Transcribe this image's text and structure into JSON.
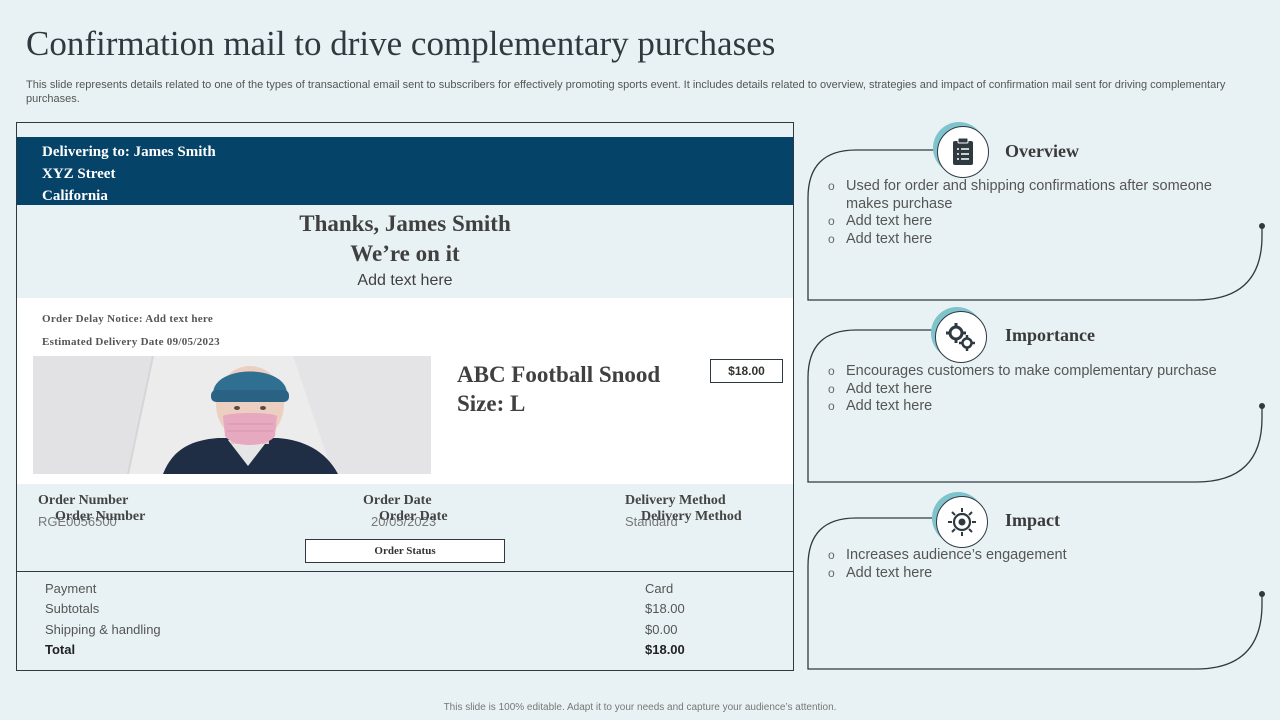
{
  "slide": {
    "title": "Confirmation mail to drive complementary purchases",
    "subtitle": "This slide represents details related to one of the types of transactional email sent to subscribers for effectively promoting sports event. It includes details related to overview, strategies and impact of confirmation mail sent for driving complementary purchases.",
    "footer": "This slide is 100% editable. Adapt it to your needs and capture your audience’s attention."
  },
  "email": {
    "delivering_to": "Delivering to: James Smith",
    "street": "XYZ Street",
    "state": "California",
    "thanks_line": "Thanks, James Smith",
    "on_it_line": "We’re on it",
    "add_text": "Add text here",
    "delay_notice": "Order Delay Notice: Add text here",
    "estimated_delivery": "Estimated Delivery Date 09/05/2023",
    "product_name": "ABC Football Snood",
    "product_size": "Size: L",
    "price": "$18.00",
    "order_headers": {
      "number": "Order Number",
      "date": "Order Date",
      "method": "Delivery Method"
    },
    "order_values": {
      "number": "RGE0056500",
      "date": "20/05/2023",
      "method": "Standard"
    },
    "order_status": "Order Status",
    "payment_rows": [
      {
        "label": "Payment",
        "value": "Card"
      },
      {
        "label": "Subtotals",
        "value": "$18.00"
      },
      {
        "label": "Shipping & handling",
        "value": "$0.00"
      },
      {
        "label": "Total",
        "value": "$18.00"
      }
    ]
  },
  "panels": [
    {
      "title": "Overview",
      "icon": "clipboard-icon",
      "bullets": [
        "Used for order and shipping confirmations after someone makes purchase",
        "Add text here",
        "Add text here"
      ]
    },
    {
      "title": "Importance",
      "icon": "gears-icon",
      "bullets": [
        "Encourages customers to make complementary purchase",
        "Add text here",
        "Add text here"
      ]
    },
    {
      "title": "Impact",
      "icon": "target-icon",
      "bullets": [
        "Increases audience’s engagement",
        "Add text here"
      ]
    }
  ],
  "colors": {
    "background": "#e8f2f4",
    "header_band": "#064369",
    "icon_accent": "#7fc3cc"
  }
}
